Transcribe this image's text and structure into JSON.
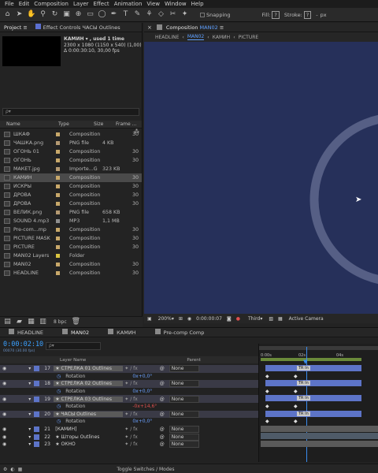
{
  "menu": [
    "File",
    "Edit",
    "Composition",
    "Layer",
    "Effect",
    "Animation",
    "View",
    "Window",
    "Help"
  ],
  "toolbar": {
    "snapping": "Snapping",
    "fill": "Fill:",
    "fill_value": "?",
    "stroke": "Stroke:",
    "stroke_value": "?",
    "stroke_width": "-",
    "px": "px"
  },
  "project": {
    "tab": "Project",
    "effect_tab": "Effect Controls ЧАСЫ Outlines",
    "comp_name": "КАМИН ▾ , used 1 time",
    "comp_size": "2300 x 1080 (1150 x 540) (1,00)",
    "comp_dur": "Δ 0:00:30:10, 30,00 fps",
    "search_placeholder": "ρ▾",
    "columns": {
      "name": "Name",
      "type": "Type",
      "size": "Size",
      "rate": "Frame ..."
    },
    "items": [
      {
        "name": "ШКАФ",
        "type": "Composition",
        "size": "",
        "rate": "30",
        "color": "#c8a86a"
      },
      {
        "name": "ЧАШКА.png",
        "type": "PNG file",
        "size": "4 KB",
        "rate": "",
        "color": "#b59a72"
      },
      {
        "name": "ОГОНЬ 01",
        "type": "Composition",
        "size": "",
        "rate": "30",
        "color": "#c8a86a"
      },
      {
        "name": "ОГОНЬ",
        "type": "Composition",
        "size": "",
        "rate": "30",
        "color": "#c8a86a"
      },
      {
        "name": "МАКЕТ.jpg",
        "type": "Importe...G",
        "size": "323 KB",
        "rate": "",
        "color": "#b59a72"
      },
      {
        "name": "КАМИН",
        "type": "Composition",
        "size": "",
        "rate": "30",
        "color": "#c8a86a"
      },
      {
        "name": "ИСКРЫ",
        "type": "Composition",
        "size": "",
        "rate": "30",
        "color": "#c8a86a"
      },
      {
        "name": "ДРОВА",
        "type": "Composition",
        "size": "",
        "rate": "30",
        "color": "#c8a86a"
      },
      {
        "name": "ДРОВА",
        "type": "Composition",
        "size": "",
        "rate": "30",
        "color": "#c8a86a"
      },
      {
        "name": "ВЕЛИК.png",
        "type": "PNG file",
        "size": "658 KB",
        "rate": "",
        "color": "#b59a72"
      },
      {
        "name": "SOUND 4.mp3",
        "type": "MP3",
        "size": "1,1 MB",
        "rate": "",
        "color": "#8f8f8f"
      },
      {
        "name": "Pre-com...mp",
        "type": "Composition",
        "size": "",
        "rate": "30",
        "color": "#c8a86a"
      },
      {
        "name": "PICTURE MASK",
        "type": "Composition",
        "size": "",
        "rate": "30",
        "color": "#c8a86a"
      },
      {
        "name": "PICTURE",
        "type": "Composition",
        "size": "",
        "rate": "30",
        "color": "#c8a86a"
      },
      {
        "name": "MAN02 Layers",
        "type": "Folder",
        "size": "",
        "rate": "",
        "color": "#d9c440"
      },
      {
        "name": "MAN02",
        "type": "Composition",
        "size": "",
        "rate": "30",
        "color": "#c8a86a"
      },
      {
        "name": "HEADLINE",
        "type": "Composition",
        "size": "",
        "rate": "30",
        "color": "#c8a86a"
      }
    ],
    "selected_index": 5,
    "bpc": "8 bpc"
  },
  "viewer": {
    "tab": "Composition",
    "tab_comp": "MAN02",
    "crumbs": [
      "HEADLINE",
      "MAN02",
      "КАМИН",
      "PICTURE"
    ],
    "zoom": "200%",
    "timecode": "0:00:00:07",
    "resolution": "Third",
    "camera": "Active Camera"
  },
  "timeline": {
    "tabs": [
      "HEADLINE",
      "MAN02",
      "КАМИН",
      "Pre-comp Comp"
    ],
    "active_tab": "MAN02",
    "timecode": "0:00:02:10",
    "timecode_sub": "00070 (30.00 fps)",
    "search_placeholder": "ρ▾",
    "col_layer": "Layer Name",
    "col_parent": "Parent",
    "ruler": [
      "0:00s",
      "02s",
      "04s"
    ],
    "footer": "Toggle Switches / Modes",
    "layers": [
      {
        "num": "17",
        "name": "★ СТРЕЛКА 01 Outlines",
        "parent": "None",
        "sel": true
      },
      {
        "prop": "Rotation",
        "value": "0x+0,0°"
      },
      {
        "num": "18",
        "name": "★ СТРЕЛКА 02 Outlines",
        "parent": "None",
        "sel": true
      },
      {
        "prop": "Rotation",
        "value": "0x+0,0°"
      },
      {
        "num": "19",
        "name": "★ СТРЕЛКА 03 Outlines",
        "parent": "None",
        "sel": true
      },
      {
        "prop": "Rotation",
        "value": "-0x+14,6°"
      },
      {
        "num": "20",
        "name": "★ ЧАСЫ Outlines",
        "parent": "None",
        "sel": true
      },
      {
        "prop": "Rotation",
        "value": "0x+0,0°"
      },
      {
        "num": "21",
        "name": "[КАМИН]",
        "parent": "None",
        "sel": false
      },
      {
        "num": "22",
        "name": "★ Шторы Outlines",
        "parent": "None",
        "sel": false
      },
      {
        "num": "23",
        "name": "★ ОКНО",
        "parent": "None",
        "sel": false
      }
    ],
    "key_label": "TR In"
  },
  "colors": {
    "comp_bg": "#26305a",
    "ring": "#565f85",
    "accent": "#2d8ceb",
    "label_blue": "#5d74c8"
  }
}
